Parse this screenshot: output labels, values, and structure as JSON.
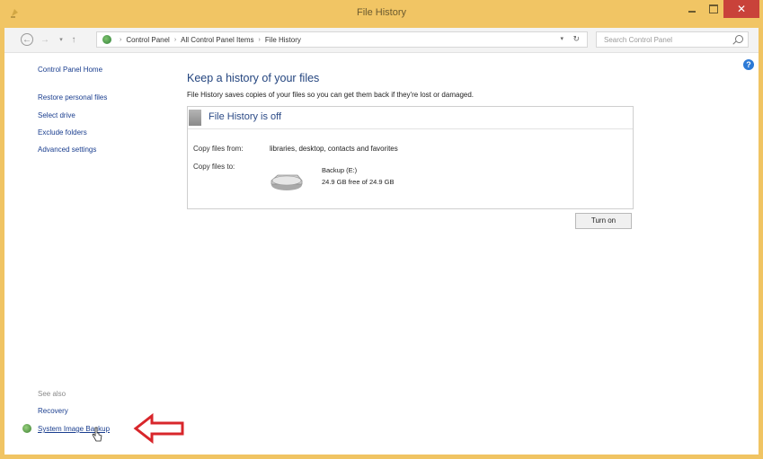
{
  "window": {
    "title": "File History"
  },
  "controls": {
    "close": "✕"
  },
  "address": {
    "crumbs": [
      "Control Panel",
      "All Control Panel Items",
      "File History"
    ],
    "separator": "›",
    "search_placeholder": "Search Control Panel"
  },
  "sidebar": {
    "home": "Control Panel Home",
    "links": [
      "Restore personal files",
      "Select drive",
      "Exclude folders",
      "Advanced settings"
    ],
    "see_also": "See also",
    "see_also_links": [
      "Recovery",
      "System Image Backup"
    ]
  },
  "main": {
    "title": "Keep a history of your files",
    "description": "File History saves copies of your files so you can get them back if they're lost or damaged.",
    "status": "File History is off",
    "copy_from_label": "Copy files from:",
    "copy_from_value": "libraries, desktop, contacts and favorites",
    "copy_to_label": "Copy files to:",
    "drive_name": "Backup (E:)",
    "drive_free": "24.9 GB free of 24.9 GB",
    "turn_on": "Turn on"
  },
  "help": {
    "symbol": "?"
  },
  "colors": {
    "title_bar": "#f1c564",
    "close_button": "#c9423a",
    "link": "#1a3e8f",
    "heading": "#24457f",
    "annotation_arrow": "#d8262b"
  },
  "icons": [
    "control-panel-icon",
    "back-icon",
    "forward-icon",
    "up-icon",
    "search-icon",
    "help-icon",
    "drive-icon",
    "system-image-icon",
    "cursor-icon",
    "red-arrow-icon"
  ]
}
